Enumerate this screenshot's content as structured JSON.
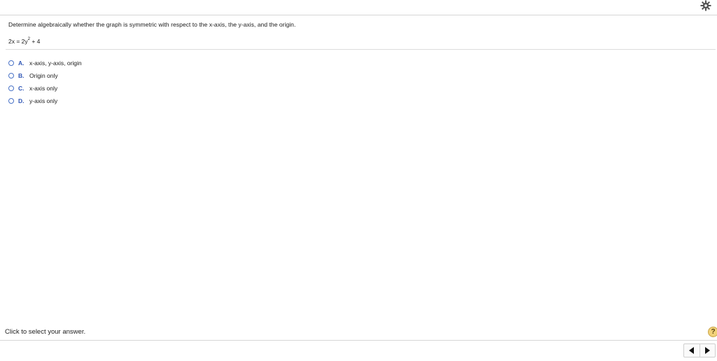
{
  "question": {
    "prompt": "Determine algebraically whether the graph is symmetric with respect to the x-axis, the y-axis, and the origin.",
    "equation_left": "2x = 2y",
    "equation_exp": "2",
    "equation_right": " + 4"
  },
  "choices": [
    {
      "letter": "A.",
      "text": "x-axis, y-axis, origin"
    },
    {
      "letter": "B.",
      "text": "Origin only"
    },
    {
      "letter": "C.",
      "text": "x-axis only"
    },
    {
      "letter": "D.",
      "text": "y-axis only"
    }
  ],
  "footer": {
    "status": "Click to select your answer.",
    "help_label": "?"
  },
  "icons": {
    "settings": "gear-icon",
    "prev": "arrow-left-icon",
    "next": "arrow-right-icon"
  },
  "colors": {
    "accent": "#2e55b5",
    "help_bg": "#f2d27a"
  }
}
